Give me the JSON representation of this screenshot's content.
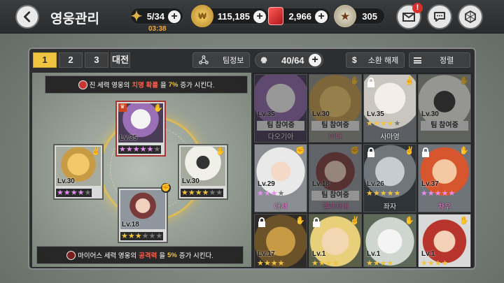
{
  "header": {
    "title": "영웅관리",
    "timer": "03:38",
    "resources": [
      {
        "name": "key",
        "value": "5/34",
        "icon": "key-icon"
      },
      {
        "name": "gold",
        "value": "115,185",
        "icon": "gold-coin-icon"
      },
      {
        "name": "ruby",
        "value": "2,966",
        "icon": "ruby-icon"
      },
      {
        "name": "honor",
        "value": "305",
        "icon": "honor-medal-icon"
      }
    ],
    "mail_badge": "!"
  },
  "toolbar": {
    "tabs": [
      "1",
      "2",
      "3"
    ],
    "active_tab": "1",
    "battle_label": "대전",
    "team_info_label": "팀정보",
    "hero_count": "40/64",
    "dismiss_label": "소환 해제",
    "sort_label": "정렬",
    "dismiss_symbol": "$"
  },
  "formation": {
    "buff_top": {
      "pre": "진 세력 영웅의 ",
      "stat": "치명 확률",
      "mid": "을 ",
      "value": "7%",
      "post": "증가 시킨다."
    },
    "buff_bottom": {
      "pre": "마이어스 세력 영웅의 ",
      "stat": "공격력",
      "mid": "을 ",
      "value": "5%",
      "post": "증가 시킨다."
    },
    "slots": [
      {
        "pos": "top",
        "level": "Lv.35",
        "stars": 5,
        "star_type": "purple",
        "max": 6
      },
      {
        "pos": "left",
        "level": "Lv.30",
        "stars": 4,
        "star_type": "purple",
        "max": 5
      },
      {
        "pos": "right",
        "level": "Lv.30",
        "stars": 4,
        "star_type": "gold",
        "max": 6
      },
      {
        "pos": "bottom",
        "level": "Lv.18",
        "stars": 3,
        "star_type": "gold",
        "max": 6
      }
    ]
  },
  "heroes": [
    {
      "level": "Lv.35",
      "join": "팀 참여중",
      "name": "다오기아",
      "stars": 0,
      "dim": true,
      "lock": false
    },
    {
      "level": "Lv.30",
      "join": "팀 참여중",
      "name": "이다",
      "stars": 0,
      "dim": true,
      "lock": false
    },
    {
      "level": "Lv.35",
      "join": "",
      "name": "사마영",
      "stars": 4,
      "star_type": "gold",
      "dim": false,
      "lock": true
    },
    {
      "level": "Lv.30",
      "join": "팀 참여중",
      "name": "",
      "stars": 0,
      "dim": true,
      "lock": false
    },
    {
      "level": "Lv.29",
      "join": "",
      "name": "애서",
      "stars": 3,
      "star_type": "purple",
      "dim": false,
      "lock": false,
      "pink": true
    },
    {
      "level": "Lv.18",
      "join": "팀 참여중",
      "name": "델라자뻬",
      "stars": 0,
      "dim": true,
      "lock": false
    },
    {
      "level": "Lv.26",
      "join": "",
      "name": "좌자",
      "stars": 5,
      "star_type": "gold",
      "dim": false,
      "lock": true
    },
    {
      "level": "Lv.37",
      "join": "",
      "name": "차우",
      "stars": 5,
      "star_type": "purple",
      "dim": false,
      "lock": true,
      "pink": true
    },
    {
      "level": "Lv.17",
      "join": "",
      "name": "",
      "stars": 4,
      "star_type": "gold",
      "dim": false,
      "lock": true
    },
    {
      "level": "Lv.1",
      "join": "",
      "name": "",
      "stars": 4,
      "star_type": "gold",
      "dim": false,
      "lock": true
    },
    {
      "level": "Lv.1",
      "join": "",
      "name": "",
      "stars": 4,
      "star_type": "gold",
      "dim": false,
      "lock": false
    },
    {
      "level": "Lv.1",
      "join": "",
      "name": "",
      "stars": 4,
      "star_type": "gold",
      "dim": false,
      "lock": false
    }
  ]
}
